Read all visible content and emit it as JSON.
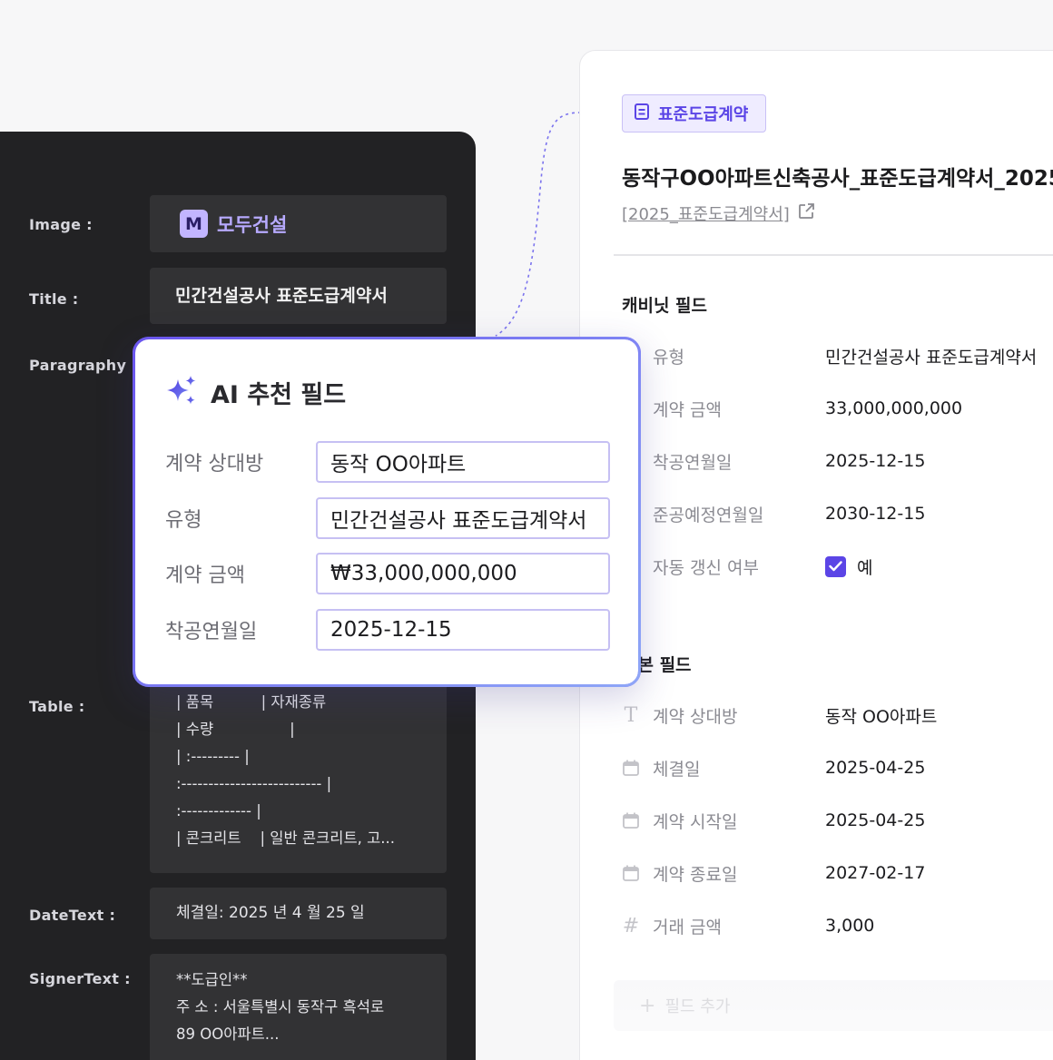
{
  "extraction": {
    "rows": [
      {
        "label": "Image :"
      },
      {
        "label": "Title :",
        "value": "민간건설공사 표준도급계약서"
      },
      {
        "label": "Paragraphy :"
      },
      {
        "label": "Table :"
      },
      {
        "label": "DateText :",
        "value": "체결일: 2025 년 4 월 25 일"
      },
      {
        "label": "SignerText :"
      }
    ],
    "logo_letter": "M",
    "logo_text": "모두건설",
    "table_lines": [
      "| 품목          | 자재종류",
      "| 수량                |",
      "| :--------- |",
      ":-------------------------- |",
      ":------------- |",
      "| 콘크리트    | 일반 콘크리트, 고..."
    ],
    "signer_lines": [
      "**도급인**",
      "주 소 : 서울특별시 동작구 흑석로",
      "89 OO아파트..."
    ]
  },
  "document": {
    "tag": "표준도급계약",
    "title": "동작구OO아파트신축공사_표준도급계약서_2025",
    "link": "[2025_표준도급계약서]",
    "cabinet_heading": "캐비닛 필드",
    "cabinet_fields": [
      {
        "label": "유형",
        "value": "민간건설공사 표준도급계약서"
      },
      {
        "label": "계약 금액",
        "value": "33,000,000,000"
      },
      {
        "label": "착공연월일",
        "value": "2025-12-15"
      },
      {
        "label": "준공예정연월일",
        "value": "2030-12-15"
      },
      {
        "label": "자동 갱신 여부",
        "value": "예",
        "checked": true
      }
    ],
    "basic_heading": "기본 필드",
    "basic_fields": [
      {
        "icon": "text-icon",
        "label": "계약 상대방",
        "value": "동작 OO아파트"
      },
      {
        "icon": "calendar-icon",
        "label": "체결일",
        "value": "2025-04-25"
      },
      {
        "icon": "calendar-icon",
        "label": "계약 시작일",
        "value": "2025-04-25"
      },
      {
        "icon": "calendar-icon",
        "label": "계약 종료일",
        "value": "2027-02-17"
      },
      {
        "icon": "hash-icon",
        "label": "거래 금액",
        "value": "3,000"
      }
    ],
    "add_field": "필드 추가"
  },
  "ai_card": {
    "title": "AI 추천 필드",
    "fields": [
      {
        "label": "계약 상대방",
        "value": "동작 OO아파트"
      },
      {
        "label": "유형",
        "value": "민간건설공사 표준도급계약서"
      },
      {
        "label": "계약 금액",
        "value": "₩33,000,000,000"
      },
      {
        "label": "착공연월일",
        "value": "2025-12-15"
      }
    ]
  },
  "colors": {
    "accent": "#5b45e6",
    "dark_panel": "#222224",
    "dark_box": "#323234",
    "logo_bg": "#c2b5ff"
  }
}
